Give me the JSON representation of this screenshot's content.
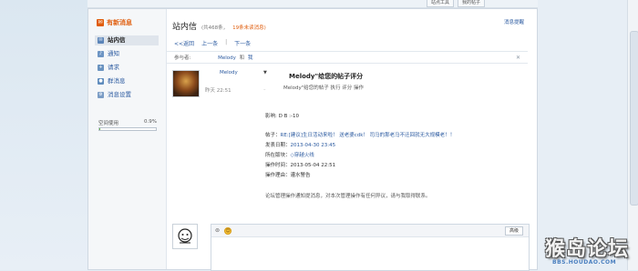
{
  "topbar": {
    "tab_1": "站点工具",
    "tab_2": "我的帖子"
  },
  "sidebar": {
    "header": "有新消息",
    "items": [
      {
        "label": "站内信",
        "icon": "envelope-icon"
      },
      {
        "label": "通知",
        "icon": "bell-icon"
      },
      {
        "label": "请求",
        "icon": "user-plus-icon"
      },
      {
        "label": "群消息",
        "icon": "group-icon"
      },
      {
        "label": "消息设置",
        "icon": "gear-icon"
      }
    ],
    "space": {
      "label": "空间使用",
      "percent_text": "0.9%",
      "percent": 0.9
    }
  },
  "header": {
    "title": "站内信",
    "count": "(共468条，",
    "unread": "19条未读消息)",
    "settings_link": "消息提醒"
  },
  "nav": {
    "back": "<<返回",
    "prev": "上一条",
    "sep": "|",
    "next": "下一条"
  },
  "participants": {
    "label": "参与者:",
    "name": "Melody",
    "and": "和",
    "me": "我",
    "close": "✕"
  },
  "message": {
    "author": "Melody",
    "time": "昨天 22:51",
    "title": "Melody\"给您的帖子评分",
    "subtitle": "Melody\"给您的帖子 执行 评分 操作",
    "impact": "影响: D B :-10",
    "post_label": "帖子：",
    "post_link": "RE:[建议]生日活动来啦！ 送老婆cdk！ 司马的那老马不迁回就无大规模老！！",
    "date_label": "发表日期：",
    "date_value": "2013-04-30 23:45",
    "board_label": "所在版块：",
    "board_value": "◇穿越火线",
    "optime_label": "操作时间：",
    "optime_value": "2013-05-04 22:51",
    "reason_label": "操作理由：",
    "reason_value": "灌水警告",
    "footer": "论坛管理操作通知提消息，对本次管理操作有任何异议，请与我取得联系。"
  },
  "reply": {
    "emoji_label": "☺",
    "advanced": "高级"
  },
  "watermark": {
    "main": "猴岛论坛",
    "url": "BBS.HOUDAO.COM"
  },
  "colors": {
    "accent": "#e05c0b",
    "link": "#2b5aa0"
  }
}
